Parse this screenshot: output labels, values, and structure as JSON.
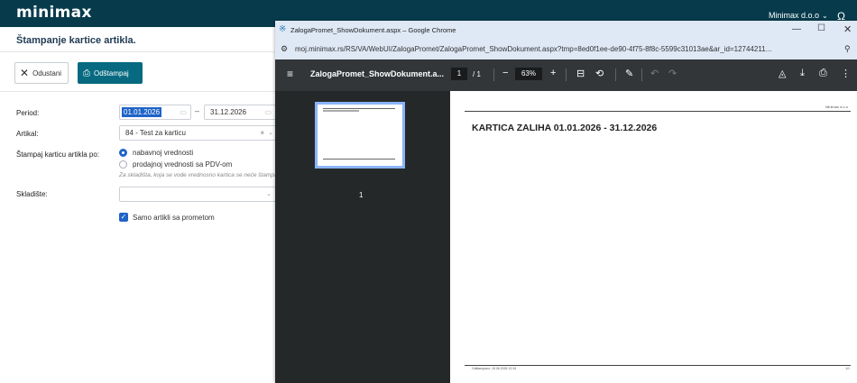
{
  "app": {
    "logo": "minimax",
    "user": "Minimax d.o.o",
    "page_title": "Štampanje kartice artikla."
  },
  "toolbar": {
    "cancel_label": "Odustani",
    "print_label": "Odštampaj"
  },
  "form": {
    "period_label": "Period:",
    "date_from": "01.01.2026",
    "date_sep": "–",
    "date_to": "31.12.2026",
    "article_label": "Artikal:",
    "article_value": "84 - Test za karticu",
    "print_value_label": "Štampaj karticu artikla po:",
    "radio_purchase": "nabavnoj vrednosti",
    "radio_sale": "prodajnoj vrednosti sa PDV-om",
    "hint": "Za skladišta, koja se vode vrednosno kartica se neće štampati",
    "warehouse_label": "Skladište:",
    "warehouse_value": "",
    "only_with_turnover": "Samo artikli sa prometom"
  },
  "chrome": {
    "window_title": "ZalogaPromet_ShowDokument.aspx – Google Chrome",
    "url": "moj.minimax.rs/RS/VA/WebUI/ZalogaPromet/ZalogaPromet_ShowDokument.aspx?tmp=8ed0f1ee-de90-4f75-8f8c-5599c31013ae&ar_id=12744211..."
  },
  "pdf": {
    "doc_name": "ZalogaPromet_ShowDokument.a...",
    "page_current": "1",
    "page_count": "/ 1",
    "zoom": "63%",
    "thumb_page_number": "1",
    "page_company": "Minimax d.o.o",
    "page_title": "KARTICA ZALIHA 01.01.2026 - 31.12.2026",
    "page_printed": "Odštampano: 15.06.2026 12:34",
    "page_info": "1/1"
  },
  "colors": {
    "topbar": "#073b4c",
    "accent_button": "#076a80",
    "selection_blue": "#1f64c7",
    "pdf_toolbar": "#323639",
    "pdf_sidebar": "#252829"
  }
}
